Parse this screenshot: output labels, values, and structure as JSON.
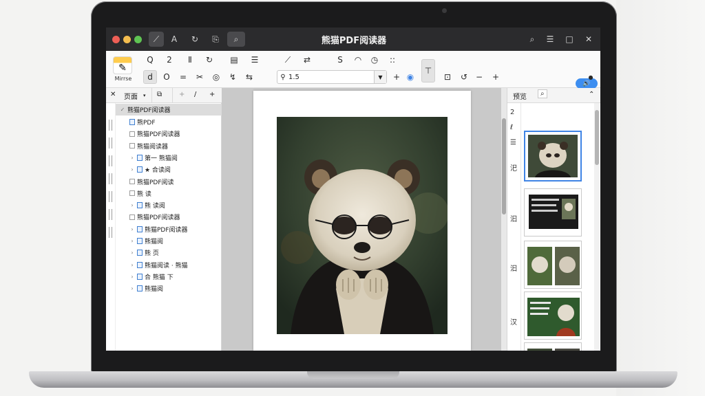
{
  "window": {
    "title": "熊猫PDF阅读器"
  },
  "titlebar": {
    "left_tools": [
      "⟋",
      "A",
      "↻",
      "⎘",
      "⌕"
    ],
    "right_tools": [
      "⌕",
      "☰",
      "□",
      "✕"
    ]
  },
  "ribbon": {
    "logo_label": "Mirrse",
    "row1_tools": [
      "Q",
      "2",
      "Ⅱ",
      "↻",
      "▤",
      "☰",
      "⟋",
      "⇄",
      "S",
      "◠",
      "◷",
      ":: "
    ],
    "row2_tools": [
      "d",
      "O",
      "=",
      "✂",
      "◎",
      "↯",
      "⇆"
    ],
    "zoom": {
      "value": "1.5"
    },
    "row2_right_tools": [
      "+",
      "◉",
      "⊤",
      "⊡",
      "↺",
      "−",
      "+"
    ],
    "share_label": "🔊"
  },
  "sidebar": {
    "header_tab": "页面",
    "header_tools": [
      "⧉",
      "+",
      "/",
      "+"
    ],
    "root_label": "熊猫PDF阅读器",
    "items": [
      {
        "label": "熊PDF",
        "icon": "doc"
      },
      {
        "label": "熊猫PDF阅读器",
        "icon": "check"
      },
      {
        "label": "熊猫阅读器",
        "icon": "folder"
      },
      {
        "label": "第一 熊猫阅",
        "icon": "doc"
      },
      {
        "label": "★ 合读阅",
        "icon": "doc"
      },
      {
        "label": "熊猫PDF阅读",
        "icon": "check"
      },
      {
        "label": "熊 读",
        "icon": "check"
      },
      {
        "label": "熊 读阅",
        "icon": "doc",
        "arrow": "↓"
      },
      {
        "label": "熊猫PDF阅读器",
        "icon": "check",
        "arrow": ">"
      },
      {
        "label": "熊猫PDF阅读器",
        "icon": "doc",
        "arrow": ">"
      },
      {
        "label": "熊猫阅",
        "icon": "doc",
        "arrow": "◦"
      },
      {
        "label": "熊 页",
        "icon": "doc"
      },
      {
        "label": "熊猫阅读 · 熊猫",
        "icon": "doc"
      },
      {
        "label": "合 熊猫 下",
        "icon": "doc"
      },
      {
        "label": "熊猫阅",
        "icon": "doc",
        "arrow": ">"
      }
    ]
  },
  "thumbpane": {
    "header_tab": "预览",
    "rail_marks": [
      "2",
      "ℓ",
      "☰",
      "汜",
      "汩",
      "汩",
      "汉"
    ]
  },
  "colors": {
    "titlebar": "#2b2b2d",
    "accent": "#3f84e5",
    "viewer_bg": "#c9c9c9"
  }
}
